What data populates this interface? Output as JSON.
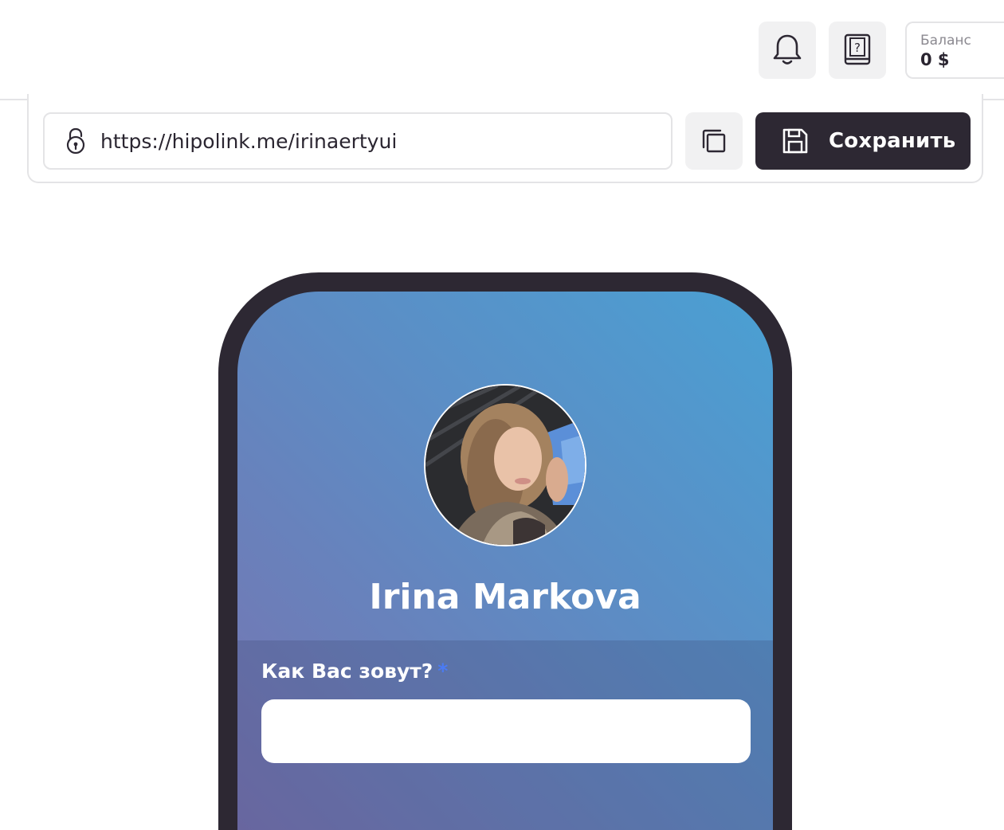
{
  "header": {
    "notifications_icon": "bell-icon",
    "help_icon": "help-book-icon",
    "balance": {
      "label": "Баланс",
      "value": "0 $"
    }
  },
  "link_bar": {
    "lock_icon": "lock-icon",
    "url": "https://hipolink.me/irinaertyui",
    "copy_icon": "copy-icon",
    "save_icon": "floppy-disk-icon",
    "save_label": "Сохранить"
  },
  "preview": {
    "profile_name": "Irina Markova",
    "form": {
      "field_label": "Как Вас зовут?",
      "required_mark": "*",
      "field_value": ""
    }
  },
  "colors": {
    "dark": "#2d2833",
    "light_button": "#f1f1f2",
    "border": "#e4e4e6",
    "gradient_start": "#4aa0d3",
    "gradient_end": "#7873b0",
    "required_star": "#4a7bf5"
  }
}
